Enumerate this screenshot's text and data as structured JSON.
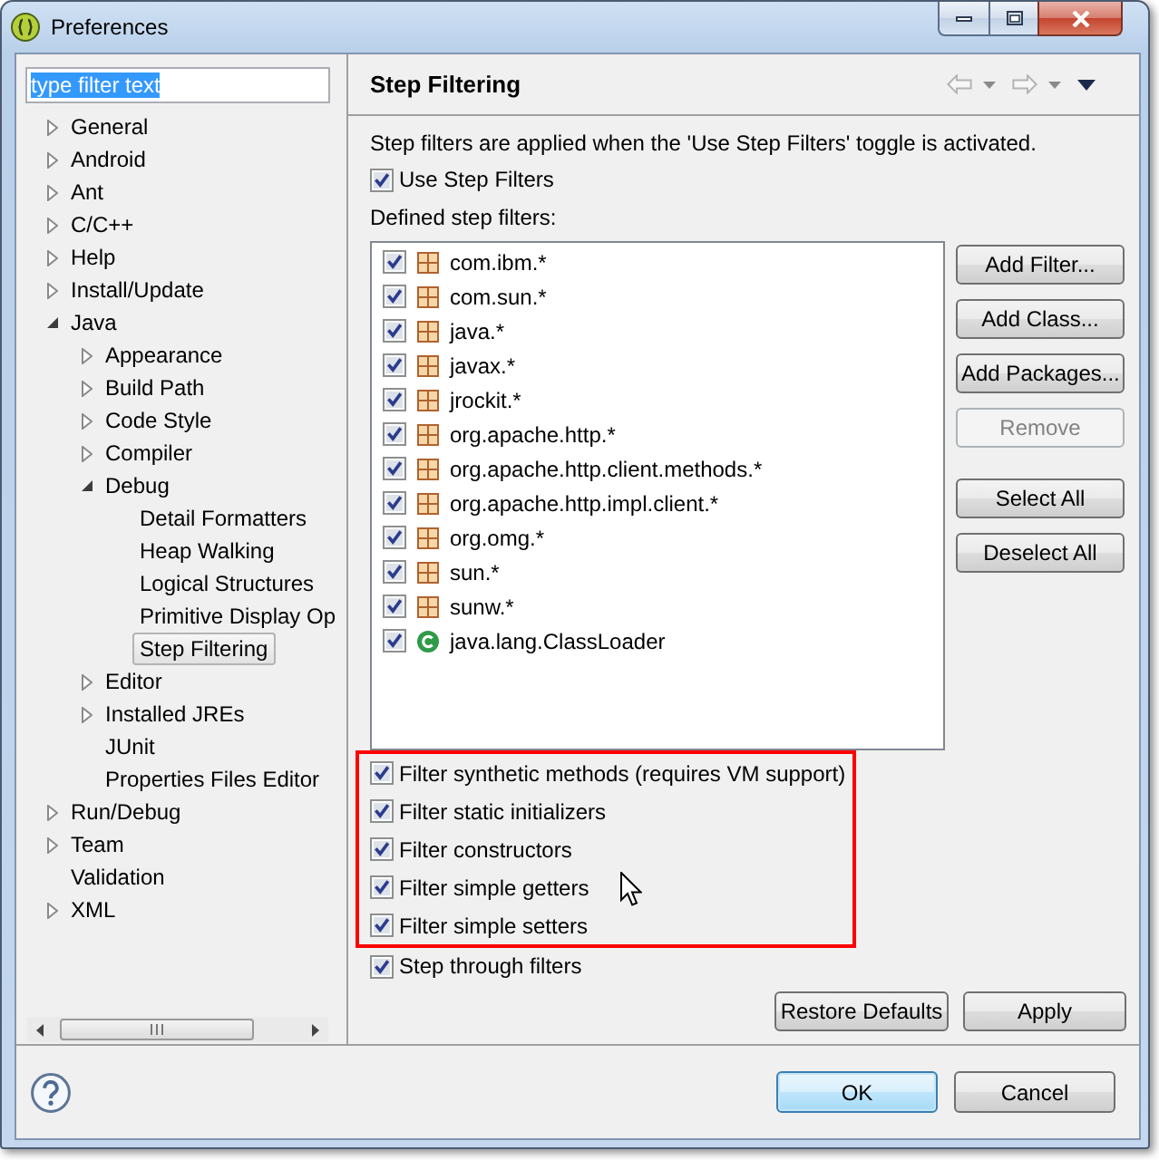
{
  "window": {
    "title": "Preferences"
  },
  "filter_field": {
    "value": "type filter text",
    "highlighted": true
  },
  "tree": [
    {
      "label": "General",
      "expanded": false,
      "selected": false
    },
    {
      "label": "Android",
      "expanded": false,
      "selected": false
    },
    {
      "label": "Ant",
      "expanded": false,
      "selected": false
    },
    {
      "label": "C/C++",
      "expanded": false,
      "selected": false
    },
    {
      "label": "Help",
      "expanded": false,
      "selected": false
    },
    {
      "label": "Install/Update",
      "expanded": false,
      "selected": false
    },
    {
      "label": "Java",
      "expanded": true,
      "selected": false,
      "children": [
        {
          "label": "Appearance",
          "expanded": false,
          "selected": false
        },
        {
          "label": "Build Path",
          "expanded": false,
          "selected": false
        },
        {
          "label": "Code Style",
          "expanded": false,
          "selected": false
        },
        {
          "label": "Compiler",
          "expanded": false,
          "selected": false
        },
        {
          "label": "Debug",
          "expanded": true,
          "selected": false,
          "children": [
            {
              "label": "Detail Formatters",
              "selected": false
            },
            {
              "label": "Heap Walking",
              "selected": false
            },
            {
              "label": "Logical Structures",
              "selected": false
            },
            {
              "label": "Primitive Display Op",
              "selected": false
            },
            {
              "label": "Step Filtering",
              "selected": true
            }
          ]
        },
        {
          "label": "Editor",
          "expanded": false,
          "selected": false
        },
        {
          "label": "Installed JREs",
          "expanded": false,
          "selected": false
        },
        {
          "label": "JUnit",
          "selected": false
        },
        {
          "label": "Properties Files Editor",
          "selected": false
        }
      ]
    },
    {
      "label": "Run/Debug",
      "expanded": false,
      "selected": false
    },
    {
      "label": "Team",
      "expanded": false,
      "selected": false
    },
    {
      "label": "Validation",
      "selected": false
    },
    {
      "label": "XML",
      "expanded": false,
      "selected": false
    }
  ],
  "page": {
    "title": "Step Filtering",
    "description": "Step filters are applied when the 'Use Step Filters' toggle is activated.",
    "use_step_filters": {
      "label": "Use Step Filters",
      "checked": true
    },
    "list_label": "Defined step filters:",
    "filters": [
      {
        "name": "com.ibm.*",
        "kind": "package",
        "checked": true
      },
      {
        "name": "com.sun.*",
        "kind": "package",
        "checked": true
      },
      {
        "name": "java.*",
        "kind": "package",
        "checked": true
      },
      {
        "name": "javax.*",
        "kind": "package",
        "checked": true
      },
      {
        "name": "jrockit.*",
        "kind": "package",
        "checked": true
      },
      {
        "name": "org.apache.http.*",
        "kind": "package",
        "checked": true
      },
      {
        "name": "org.apache.http.client.methods.*",
        "kind": "package",
        "checked": true
      },
      {
        "name": "org.apache.http.impl.client.*",
        "kind": "package",
        "checked": true
      },
      {
        "name": "org.omg.*",
        "kind": "package",
        "checked": true
      },
      {
        "name": "sun.*",
        "kind": "package",
        "checked": true
      },
      {
        "name": "sunw.*",
        "kind": "package",
        "checked": true
      },
      {
        "name": "java.lang.ClassLoader",
        "kind": "class",
        "checked": true
      }
    ],
    "edit_buttons": [
      {
        "label": "Add Filter...",
        "disabled": false
      },
      {
        "label": "Add Class...",
        "disabled": false
      },
      {
        "label": "Add Packages...",
        "disabled": false
      },
      {
        "label": "Remove",
        "disabled": true
      }
    ],
    "selection_buttons": [
      {
        "label": "Select All",
        "disabled": false
      },
      {
        "label": "Deselect All",
        "disabled": false
      }
    ],
    "options_highlighted": true,
    "options": [
      {
        "label": "Filter synthetic methods (requires VM support)",
        "checked": true
      },
      {
        "label": "Filter static initializers",
        "checked": true
      },
      {
        "label": "Filter constructors",
        "checked": true
      },
      {
        "label": "Filter simple getters",
        "checked": true
      },
      {
        "label": "Filter simple setters",
        "checked": true
      }
    ],
    "step_through": {
      "label": "Step through filters",
      "checked": true
    },
    "page_buttons": [
      {
        "label": "Restore Defaults"
      },
      {
        "label": "Apply"
      }
    ]
  },
  "dialog_buttons": [
    {
      "label": "OK",
      "default": true
    },
    {
      "label": "Cancel",
      "default": false
    }
  ]
}
